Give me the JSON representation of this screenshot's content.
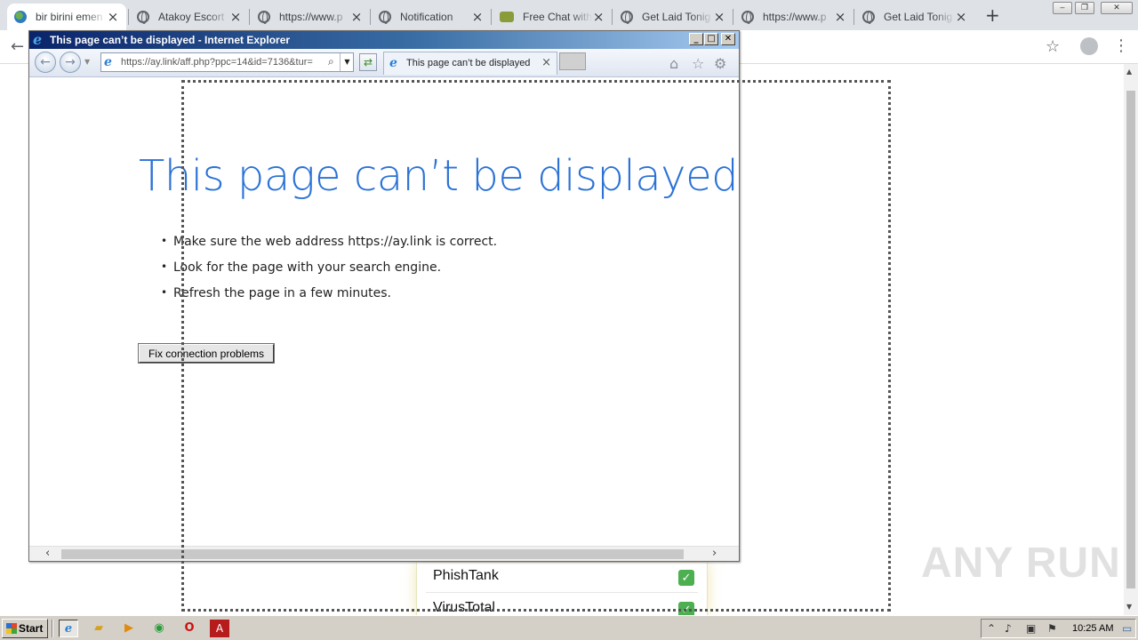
{
  "chrome": {
    "tabs": [
      {
        "title": "bir birini emen",
        "icon": "colorful-globe",
        "active": true
      },
      {
        "title": "Atakoy Escort",
        "icon": "globe"
      },
      {
        "title": "https://www.p",
        "icon": "globe"
      },
      {
        "title": "Notification",
        "icon": "globe"
      },
      {
        "title": "Free Chat with",
        "icon": "chat"
      },
      {
        "title": "Get Laid Tonig",
        "icon": "globe"
      },
      {
        "title": "https://www.p",
        "icon": "globe"
      },
      {
        "title": "Get Laid Tonig",
        "icon": "globe"
      }
    ],
    "results": [
      {
        "name": "PhishTank",
        "status": "✓"
      },
      {
        "name": "VirusTotal",
        "status": "✓"
      }
    ]
  },
  "ie": {
    "window_title": "This page can’t be displayed - Internet Explorer",
    "url": "https://ay.link/aff.php?ppc=14&id=7136&tur=",
    "tab_title": "This page can’t be displayed",
    "heading": "This page can’t be displayed",
    "tips": [
      "Make sure the web address https://ay.link is correct.",
      "Look for the page with your search engine.",
      "Refresh the page in a few minutes."
    ],
    "fix_button": "Fix connection problems"
  },
  "watermark": "ANY RUN",
  "taskbar": {
    "start": "Start",
    "clock": "10:25 AM"
  },
  "colors": {
    "ie_heading": "#2b72d6",
    "ie_title_gradient_start": "#0a246a",
    "check_green": "#4caf50",
    "chrome_tabstrip": "#dee1e6"
  }
}
